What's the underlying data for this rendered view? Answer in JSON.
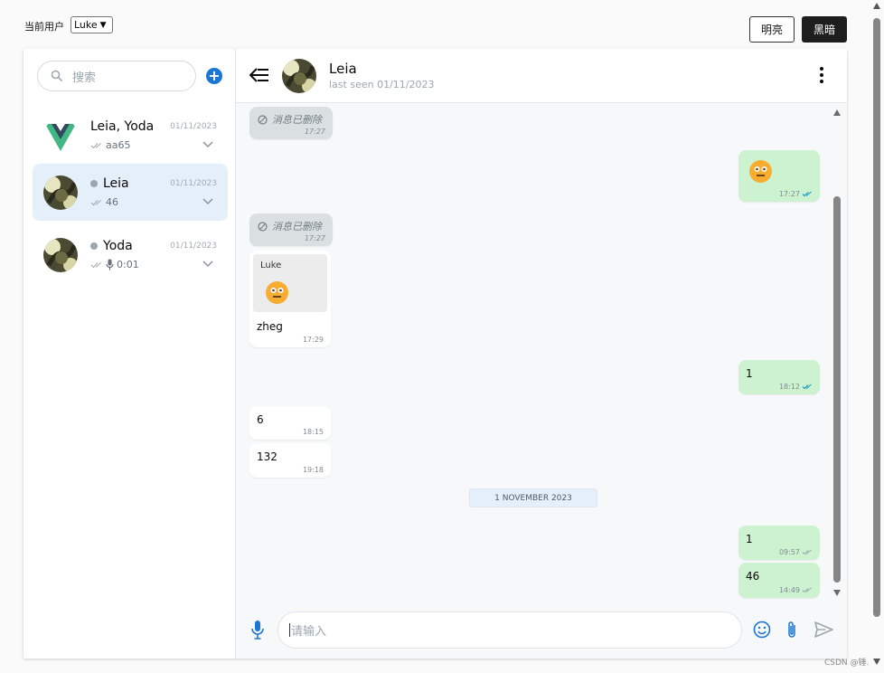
{
  "topbar": {
    "user_label": "当前用户",
    "user_select_value": "Luke",
    "light_button": "明亮",
    "dark_button": "黑暗"
  },
  "sidebar": {
    "search_placeholder": "搜索",
    "add_icon": "plus-circle-icon",
    "rooms": [
      {
        "name": "Leia, Yoda",
        "date": "01/11/2023",
        "last_message": "aa65",
        "status": "double-check",
        "avatar": "vue-logo"
      },
      {
        "name": "Leia",
        "date": "01/11/2023",
        "last_message": "46",
        "status": "double-check",
        "online_dot": true,
        "avatar": "photo"
      },
      {
        "name": "Yoda",
        "date": "01/11/2023",
        "last_message": "0:01",
        "status": "double-check",
        "audio": true,
        "online_dot": true,
        "avatar": "photo"
      }
    ]
  },
  "chat": {
    "header": {
      "name": "Leia",
      "info": "last seen 01/11/2023"
    },
    "messages": [
      {
        "side": "in",
        "deleted": true,
        "text": "消息已删除",
        "time": "17:27"
      },
      {
        "side": "out",
        "emoji": true,
        "time": "17:27",
        "status": "seen"
      },
      {
        "side": "in",
        "deleted": true,
        "text": "消息已删除",
        "time": "17:27"
      },
      {
        "side": "in",
        "reply_to": "Luke",
        "reply_emoji": true,
        "text": "zheg",
        "time": "17:29"
      },
      {
        "side": "out",
        "text": "1",
        "time": "18:12",
        "status": "seen"
      },
      {
        "side": "in",
        "text": "6",
        "time": "18:15"
      },
      {
        "side": "in",
        "text": "132",
        "time": "19:18"
      },
      {
        "side": "out",
        "text": "1",
        "time": "09:57",
        "status": "delivered"
      },
      {
        "side": "out",
        "text": "46",
        "time": "14:49",
        "status": "delivered"
      }
    ],
    "date_separator": "1 NOVEMBER 2023",
    "input_placeholder": "请输入"
  },
  "watermark": "CSDN @锤.",
  "colors": {
    "accent": "#1976d2",
    "out_bubble": "#ccf2cf",
    "active_room": "#e5effa",
    "seen_check": "#0696c7"
  }
}
